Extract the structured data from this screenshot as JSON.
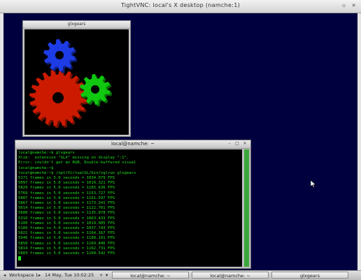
{
  "vnc_window": {
    "title": "TightVNC: local's X desktop (namche:1)",
    "controls": {
      "maximize": "▫",
      "close": "✕"
    }
  },
  "glxgears_window": {
    "title": "glxgears",
    "colors": {
      "red_gear": "#cc1a00",
      "green_gear": "#0fc80f",
      "blue_gear": "#1e3ce6"
    }
  },
  "terminal_window": {
    "title": "local@namche: ~",
    "controls": {
      "minimize": "–",
      "maximize": "□",
      "close": "✕"
    },
    "lines": [
      "local@namche:~$ glxgears",
      "Xlib:  extension \"GLX\" missing on display \":1\".",
      "Error: couldn't get an RGB, Double-buffered visual",
      "local@namche:~$",
      "local@namche:~$ /opt/VirtualGL/bin/vglrun glxgears",
      "5171 frames in 5.0 seconds = 1034.079 FPS",
      "5097 frames in 5.0 seconds = 1019.321 FPS",
      "5829 frames in 5.0 seconds = 1165.636 FPS",
      "5769 frames in 5.0 seconds = 1153.727 FPS",
      "5807 frames in 5.0 seconds = 1161.597 FPS",
      "5867 frames in 5.0 seconds = 1173.341 FPS",
      "5614 frames in 5.0 seconds = 1122.761 FPS",
      "5680 frames in 5.0 seconds = 1135.878 FPS",
      "5316 frames in 5.0 seconds = 1063.433 FPS",
      "5100 frames in 5.0 seconds = 1019.905 FPS",
      "5189 frames in 5.0 seconds = 1037.743 FPS",
      "5821 frames in 5.0 seconds = 1164.167 FPS",
      "5946 frames in 5.0 seconds = 1189.191 FPS",
      "5850 frames in 5.0 seconds = 1169.846 FPS",
      "5814 frames in 5.0 seconds = 1162.731 FPS",
      "5803 frames in 5.0 seconds = 1160.542 FPS"
    ],
    "colors": {
      "text": "#22e022",
      "background": "#000000",
      "scrollbar": "#3aa63a"
    }
  },
  "taskbar": {
    "workspace_label": "Workspace 1",
    "left_arrow": "◂",
    "right_arrow": "▸",
    "clock": "14 May, Tue 10:02:25",
    "add_button": "+",
    "menu_button": "▾",
    "tasks": [
      "local@namche: ~",
      "local@namche: ~",
      "glxgears"
    ]
  },
  "desktop": {
    "background_color": "#00003e"
  }
}
